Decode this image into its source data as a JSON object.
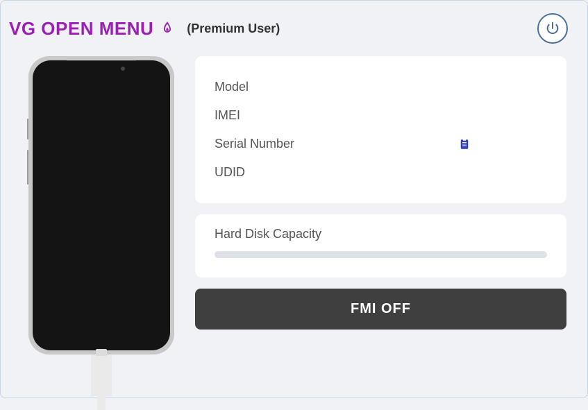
{
  "header": {
    "title": "VG OPEN MENU",
    "userBadge": "(Premium User)"
  },
  "device": {
    "fields": {
      "model": {
        "label": "Model",
        "value": ""
      },
      "imei": {
        "label": "IMEI",
        "value": ""
      },
      "serial": {
        "label": "Serial Number",
        "value": ""
      },
      "udid": {
        "label": "UDID",
        "value": ""
      }
    }
  },
  "storage": {
    "label": "Hard Disk Capacity"
  },
  "actions": {
    "fmiOff": "FMI OFF"
  }
}
